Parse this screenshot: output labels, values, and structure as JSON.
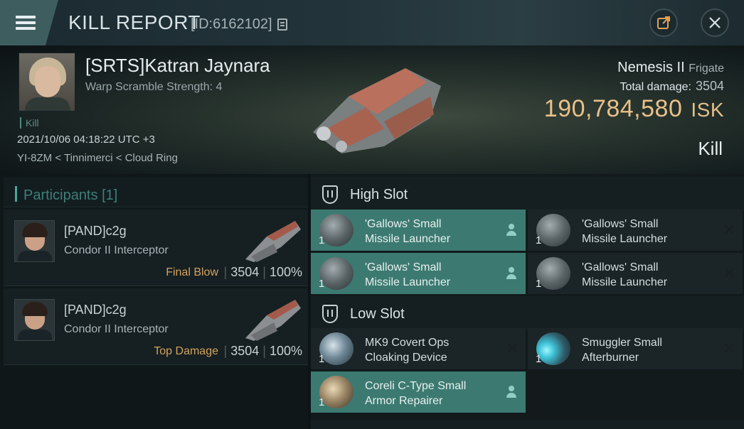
{
  "header": {
    "title": "KILL REPORT",
    "report_id": "[ID:6162102]"
  },
  "victim": {
    "name": "[SRTS]Katran Jaynara",
    "warp_scramble": "Warp Scramble Strength: 4",
    "kill_tag": "Kill",
    "datetime": "2021/10/06 04:18:22 UTC +3",
    "location": "YI-8ZM < Tinnimerci < Cloud Ring",
    "ship_name": "Nemesis II",
    "ship_class": "Frigate",
    "total_damage_label": "Total damage:",
    "total_damage_value": "3504",
    "isk_value": "190,784,580",
    "isk_unit": "ISK",
    "result_label": "Kill"
  },
  "participants": {
    "header_label": "Participants",
    "count": "[1]",
    "items": [
      {
        "name": "[PAND]c2g",
        "ship": "Condor II Interceptor",
        "role": "Final Blow",
        "damage": "3504",
        "percent": "100%"
      },
      {
        "name": "[PAND]c2g",
        "ship": "Condor II Interceptor",
        "role": "Top Damage",
        "damage": "3504",
        "percent": "100%"
      }
    ]
  },
  "slots": {
    "high": {
      "title": "High Slot",
      "modules": [
        {
          "qty": "1",
          "line1": "'Gallows' Small",
          "line2": "Missile Launcher",
          "status": "dropped"
        },
        {
          "qty": "1",
          "line1": "'Gallows' Small",
          "line2": "Missile Launcher",
          "status": "destroyed"
        },
        {
          "qty": "1",
          "line1": "'Gallows' Small",
          "line2": "Missile Launcher",
          "status": "dropped"
        },
        {
          "qty": "1",
          "line1": "'Gallows' Small",
          "line2": "Missile Launcher",
          "status": "destroyed"
        }
      ]
    },
    "low": {
      "title": "Low Slot",
      "modules": [
        {
          "qty": "1",
          "line1": "MK9 Covert Ops",
          "line2": "Cloaking Device",
          "status": "destroyed"
        },
        {
          "qty": "1",
          "line1": "Smuggler Small",
          "line2": "Afterburner",
          "status": "destroyed"
        },
        {
          "qty": "1",
          "line1": "Coreli C-Type Small",
          "line2": "Armor Repairer",
          "status": "dropped"
        }
      ]
    }
  },
  "colors": {
    "accent_teal": "#3c7a71",
    "isk_gold": "#e9c089",
    "role_orange": "#d2a35e"
  }
}
